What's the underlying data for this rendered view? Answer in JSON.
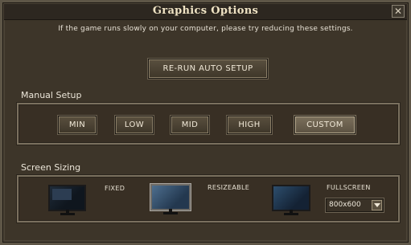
{
  "window": {
    "title": "Graphics Options",
    "close_glyph": "✕",
    "subtitle": "If the game runs slowly on your computer, please try reducing these settings."
  },
  "auto_setup": {
    "rerun_label": "RE-RUN AUTO SETUP"
  },
  "manual_setup": {
    "title": "Manual Setup",
    "presets": [
      {
        "label": "MIN",
        "selected": false
      },
      {
        "label": "LOW",
        "selected": false
      },
      {
        "label": "MID",
        "selected": false
      },
      {
        "label": "HIGH",
        "selected": false
      },
      {
        "label": "CUSTOM",
        "selected": true
      }
    ]
  },
  "screen_sizing": {
    "title": "Screen Sizing",
    "modes": [
      {
        "label": "FIXED",
        "icon": "monitor-icon",
        "selected": false
      },
      {
        "label": "RESIZEABLE",
        "icon": "monitor-icon",
        "selected": true
      },
      {
        "label": "FULLSCREEN",
        "icon": "monitor-icon",
        "selected": false
      }
    ],
    "resolution": {
      "value": "800x600",
      "icon": "chevron-down-icon"
    }
  },
  "colors": {
    "panel": "#3d3529",
    "button_text": "#f0e8d7",
    "title_text": "#efe3c4"
  }
}
